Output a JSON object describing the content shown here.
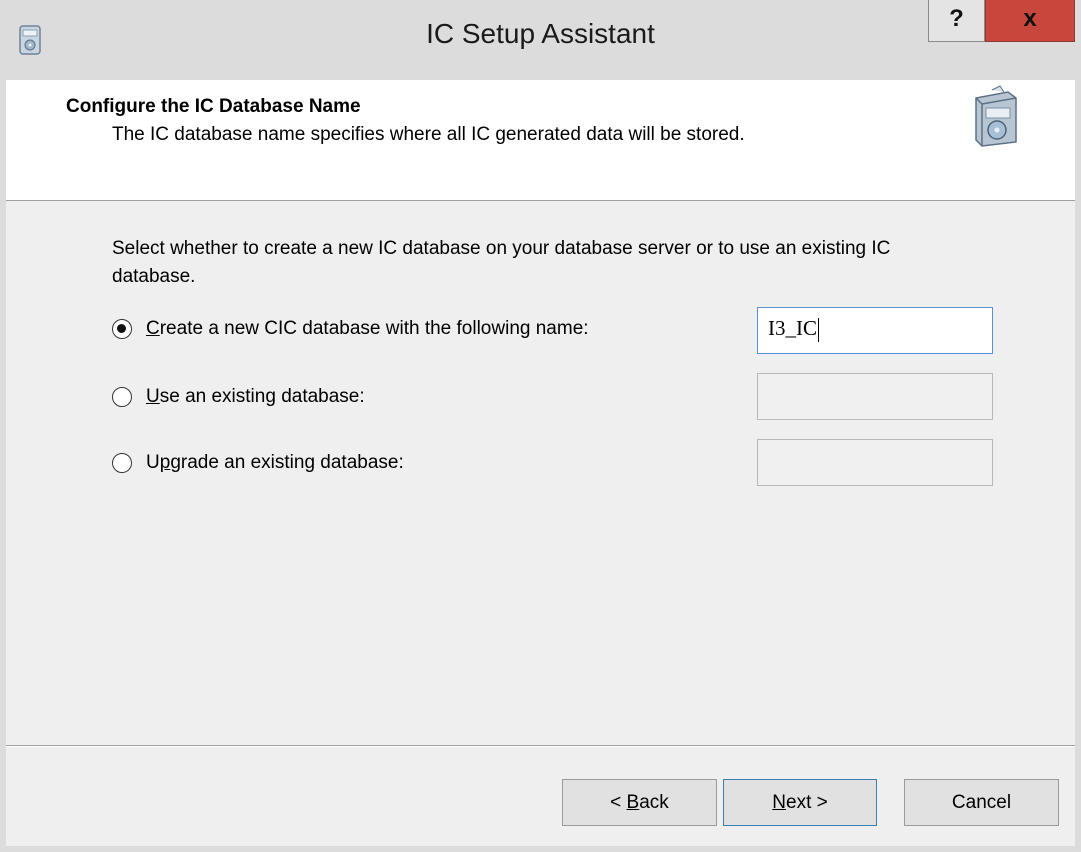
{
  "window": {
    "title": "IC Setup Assistant",
    "help_label": "?",
    "close_label": "x"
  },
  "header": {
    "title": "Configure the IC Database Name",
    "subtitle": "The IC database name specifies where all IC generated data will be stored."
  },
  "content": {
    "prompt": "Select whether to create a new IC database on your database server or to use an existing IC database.",
    "options": [
      {
        "label_pre": "",
        "mnemonic": "C",
        "label_post": "reate a new CIC database with the following name:",
        "selected": true,
        "field_value": "I3_IC"
      },
      {
        "label_pre": "",
        "mnemonic": "U",
        "label_post": "se an existing database:",
        "selected": false,
        "field_value": ""
      },
      {
        "label_pre": "U",
        "mnemonic": "p",
        "label_post": "grade an existing database:",
        "selected": false,
        "field_value": ""
      }
    ]
  },
  "buttons": {
    "back": {
      "pre": "< ",
      "mnemonic": "B",
      "post": "ack"
    },
    "next": {
      "pre": "",
      "mnemonic": "N",
      "post": "ext >"
    },
    "cancel": "Cancel"
  }
}
